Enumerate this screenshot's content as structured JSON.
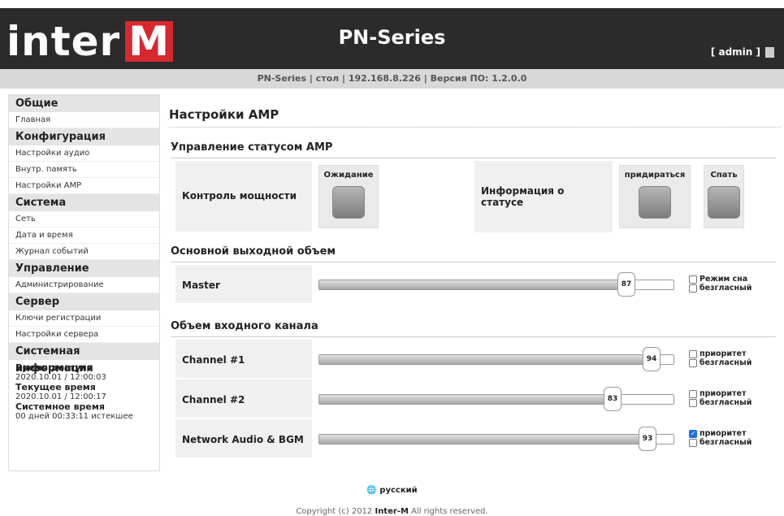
{
  "header": {
    "logo_text": "inter",
    "logo_m": "M",
    "title": "PN-Series",
    "user": "[  admin  ]"
  },
  "infobar": "PN-Series  |  стол  |  192.168.8.226  |  Версия ПО: 1.2.0.0",
  "sidebar": {
    "sections": [
      {
        "title": "Общие",
        "items": [
          "Главная"
        ]
      },
      {
        "title": "Конфигурация",
        "items": [
          "Настройки аудио",
          "Внутр. память",
          "Настройки AMP"
        ]
      },
      {
        "title": "Система",
        "items": [
          "Сеть",
          "Дата и время",
          "Журнал событий"
        ]
      },
      {
        "title": "Управление",
        "items": [
          "Администрирование"
        ]
      },
      {
        "title": "Сервер",
        "items": [
          "Ключи регистрации",
          "Настройки сервера"
        ]
      },
      {
        "title": "Системная информация",
        "items": []
      }
    ],
    "sysinfo": {
      "access_label": "Время доступа",
      "access_value": "2020.10.01 / 12:00:03",
      "current_label": "Текущее время",
      "current_value": "2020.10.01 / 12:00:17",
      "system_label": "Системное время",
      "system_value": "00 дней 00:33:11 истекшее"
    }
  },
  "main": {
    "title": "Настройки AMP",
    "status": {
      "section_title": "Управление статусом AMP",
      "power_label": "Контроль мощности",
      "standby_label": "Ожидание",
      "info_label": "Информация о статусе",
      "pick_label": "придираться",
      "sleep_label": "Спать"
    },
    "master": {
      "section_title": "Основной выходной объем",
      "label": "Master",
      "value": 87,
      "cb1": "Режим сна",
      "cb2": "безгласный"
    },
    "input": {
      "section_title": "Объем входного канала",
      "channels": [
        {
          "label": "Channel #1",
          "value": 94,
          "cb1": "приоритет",
          "cb2": "безгласный",
          "priority": false
        },
        {
          "label": "Channel #2",
          "value": 83,
          "cb1": "приоритет",
          "cb2": "безгласный",
          "priority": false
        },
        {
          "label": "Network Audio & BGM",
          "value": 93,
          "cb1": "приоритет",
          "cb2": "безгласный",
          "priority": true
        }
      ]
    }
  },
  "footer": {
    "language": "русский",
    "copyright_prefix": "Copyright (c) 2012 ",
    "copyright_brand": "Inter-M",
    "copyright_suffix": " All rights reserved."
  }
}
